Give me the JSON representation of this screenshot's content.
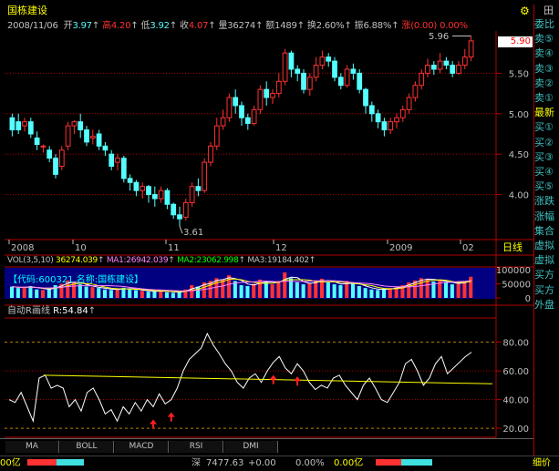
{
  "header": {
    "stock_name": "国栋建设",
    "date": "2008/11/06",
    "open_label": "开",
    "open": "3.97",
    "high_label": "高",
    "high": "4.20",
    "low_label": "低",
    "low": "3.92",
    "close_label": "收",
    "close": "4.07",
    "vol_label": "量",
    "vol": "36274",
    "amount_label": "额",
    "amount": "1489",
    "turnover_label": "换",
    "turnover": "2.60%",
    "amplitude_label": "振",
    "amplitude": "6.88%",
    "change_label": "涨",
    "change": "(0.00)",
    "change_pct": "0.00%",
    "top_icon": "settings-gear-icon",
    "top_right_text": "田"
  },
  "price_chart": {
    "y_ticks": [
      "5.50",
      "5.00",
      "4.50",
      "4.00"
    ],
    "current_price": "5.90",
    "high_note": "5.96",
    "low_note": "3.61",
    "x_labels": [
      "2008",
      "10",
      "11",
      "12",
      "2009",
      "02"
    ],
    "period": "日线"
  },
  "volume": {
    "label": "VOL(3,5,10)",
    "vol_value": "36274.039",
    "ma1": "MA1:26942.039",
    "ma2": "MA2:23062.998",
    "ma3": "MA3:19184.402",
    "code_caption": "【代码:600321 名称:国栋建设】",
    "y_ticks": [
      "100000",
      "50000",
      "0"
    ]
  },
  "indicator": {
    "name": "自动R画线",
    "value_label": "R:54.84",
    "y_ticks": [
      "80.00",
      "60.00",
      "40.00",
      "20.00"
    ]
  },
  "tabs": [
    "MA",
    "BOLL",
    "MACD",
    "RSI",
    "DMI"
  ],
  "sidebar": [
    "委比",
    "卖⑤",
    "卖④",
    "卖③",
    "卖②",
    "卖①",
    "最新",
    "买①",
    "买②",
    "买③",
    "买④",
    "买⑤",
    "涨跌",
    "涨幅",
    "集合",
    "虚拟",
    "虚拟",
    "买方",
    "买方",
    "外盘"
  ],
  "status_bar": {
    "left": "00亿",
    "index_name": "深",
    "index_value": "7477.63",
    "index_change": "+0.00",
    "index_pct": "0.00%",
    "index_amount": "0.00亿",
    "right": "细价"
  },
  "colors": {
    "up": "#ff3232",
    "down": "#54ffff",
    "ma_white": "#ffffff",
    "ma_yellow": "#ffff00",
    "ma_magenta": "#ff80ff",
    "ma_green": "#00ff00",
    "grid": "#b00000",
    "panel_blue": "#000080"
  },
  "chart_data": {
    "type": "candlestick",
    "title": "国栋建设",
    "ylim": [
      3.5,
      6.0
    ],
    "x_labels": [
      "2008",
      "10",
      "11",
      "12",
      "2009",
      "02"
    ],
    "ohlc": [
      [
        4.95,
        4.8,
        5.0,
        4.72
      ],
      [
        4.9,
        4.8,
        5.0,
        4.75
      ],
      [
        4.85,
        4.9,
        4.95,
        4.78
      ],
      [
        4.9,
        4.75,
        4.95,
        4.7
      ],
      [
        4.7,
        4.62,
        4.78,
        4.55
      ],
      [
        4.6,
        4.6,
        4.62,
        4.52
      ],
      [
        4.55,
        4.45,
        4.6,
        4.4
      ],
      [
        4.45,
        4.25,
        4.5,
        4.2
      ],
      [
        4.35,
        4.55,
        4.6,
        4.3
      ],
      [
        4.6,
        4.85,
        4.9,
        4.55
      ],
      [
        4.85,
        4.9,
        4.92,
        4.75
      ],
      [
        4.9,
        4.8,
        5.0,
        4.7
      ],
      [
        4.8,
        4.65,
        4.85,
        4.6
      ],
      [
        4.7,
        4.72,
        4.8,
        4.62
      ],
      [
        4.75,
        4.6,
        4.8,
        4.55
      ],
      [
        4.6,
        4.55,
        4.65,
        4.48
      ],
      [
        4.5,
        4.35,
        4.55,
        4.3
      ],
      [
        4.4,
        4.45,
        4.5,
        4.3
      ],
      [
        4.45,
        4.2,
        4.48,
        4.15
      ],
      [
        4.2,
        4.15,
        4.25,
        4.05
      ],
      [
        4.15,
        4.05,
        4.18,
        3.98
      ],
      [
        4.05,
        4.1,
        4.15,
        3.95
      ],
      [
        4.1,
        4.0,
        4.12,
        3.9
      ],
      [
        4.0,
        3.95,
        4.1,
        3.85
      ],
      [
        3.95,
        4.05,
        4.1,
        3.9
      ],
      [
        4.05,
        3.88,
        4.08,
        3.82
      ],
      [
        3.88,
        3.75,
        3.9,
        3.7
      ],
      [
        3.75,
        3.7,
        3.85,
        3.61
      ],
      [
        3.72,
        3.9,
        3.95,
        3.68
      ],
      [
        3.9,
        4.1,
        4.15,
        3.85
      ],
      [
        4.1,
        4.05,
        4.2,
        3.98
      ],
      [
        4.05,
        4.4,
        4.45,
        4.02
      ],
      [
        4.4,
        4.6,
        4.65,
        4.35
      ],
      [
        4.6,
        4.85,
        4.95,
        4.55
      ],
      [
        4.85,
        4.95,
        5.05,
        4.8
      ],
      [
        4.95,
        5.2,
        5.25,
        4.9
      ],
      [
        5.2,
        5.1,
        5.3,
        5.0
      ],
      [
        5.1,
        4.95,
        5.15,
        4.85
      ],
      [
        4.95,
        4.88,
        5.0,
        4.8
      ],
      [
        4.88,
        5.05,
        5.1,
        4.85
      ],
      [
        5.05,
        5.3,
        5.35,
        5.0
      ],
      [
        5.3,
        5.2,
        5.4,
        5.1
      ],
      [
        5.2,
        5.25,
        5.3,
        5.12
      ],
      [
        5.25,
        5.4,
        5.5,
        5.2
      ],
      [
        5.4,
        5.75,
        5.8,
        5.35
      ],
      [
        5.75,
        5.55,
        5.78,
        5.45
      ],
      [
        5.55,
        5.5,
        5.6,
        5.4
      ],
      [
        5.5,
        5.3,
        5.55,
        5.25
      ],
      [
        5.3,
        5.45,
        5.5,
        5.22
      ],
      [
        5.45,
        5.6,
        5.7,
        5.4
      ],
      [
        5.6,
        5.7,
        5.78,
        5.55
      ],
      [
        5.7,
        5.65,
        5.75,
        5.58
      ],
      [
        5.65,
        5.45,
        5.7,
        5.4
      ],
      [
        5.45,
        5.35,
        5.5,
        5.3
      ],
      [
        5.35,
        5.55,
        5.6,
        5.32
      ],
      [
        5.55,
        5.5,
        5.62,
        5.42
      ],
      [
        5.5,
        5.3,
        5.55,
        5.25
      ],
      [
        5.3,
        5.1,
        5.32,
        5.0
      ],
      [
        5.1,
        5.0,
        5.15,
        4.9
      ],
      [
        5.0,
        4.9,
        5.05,
        4.82
      ],
      [
        4.9,
        4.8,
        4.95,
        4.72
      ],
      [
        4.8,
        4.9,
        4.95,
        4.75
      ],
      [
        4.9,
        4.95,
        5.0,
        4.82
      ],
      [
        4.95,
        5.05,
        5.1,
        4.9
      ],
      [
        5.05,
        5.2,
        5.25,
        5.0
      ],
      [
        5.2,
        5.35,
        5.4,
        5.15
      ],
      [
        5.35,
        5.5,
        5.55,
        5.3
      ],
      [
        5.5,
        5.6,
        5.68,
        5.45
      ],
      [
        5.6,
        5.55,
        5.65,
        5.48
      ],
      [
        5.55,
        5.65,
        5.75,
        5.5
      ],
      [
        5.65,
        5.6,
        5.7,
        5.55
      ],
      [
        5.6,
        5.5,
        5.65,
        5.45
      ],
      [
        5.5,
        5.6,
        5.65,
        5.48
      ],
      [
        5.6,
        5.7,
        5.8,
        5.55
      ],
      [
        5.7,
        5.9,
        5.96,
        5.65
      ]
    ],
    "volume": [
      40,
      35,
      38,
      42,
      30,
      28,
      33,
      45,
      50,
      62,
      55,
      48,
      40,
      38,
      35,
      30,
      28,
      32,
      36,
      30,
      28,
      25,
      22,
      24,
      26,
      20,
      18,
      22,
      30,
      45,
      40,
      55,
      60,
      70,
      65,
      80,
      60,
      45,
      42,
      50,
      65,
      55,
      48,
      60,
      90,
      70,
      55,
      48,
      52,
      62,
      68,
      55,
      48,
      45,
      60,
      50,
      42,
      35,
      30,
      28,
      32,
      35,
      38,
      45,
      55,
      62,
      70,
      68,
      58,
      62,
      55,
      48,
      52,
      60,
      75
    ],
    "indicator": {
      "name": "自动R画线",
      "ylim": [
        15,
        95
      ],
      "r_line": [
        40,
        38,
        45,
        35,
        25,
        55,
        57,
        48,
        50,
        48,
        35,
        40,
        32,
        45,
        48,
        40,
        30,
        33,
        25,
        35,
        30,
        38,
        32,
        40,
        35,
        44,
        37,
        40,
        48,
        60,
        68,
        72,
        76,
        86,
        78,
        72,
        65,
        60,
        52,
        48,
        55,
        58,
        52,
        60,
        66,
        70,
        62,
        58,
        65,
        60,
        52,
        47,
        50,
        48,
        55,
        57,
        50,
        45,
        40,
        50,
        55,
        48,
        40,
        38,
        45,
        52,
        65,
        68,
        60,
        50,
        55,
        65,
        70,
        58,
        62,
        66,
        70,
        73
      ],
      "trend_line": [
        57,
        51
      ],
      "up_arrows": [
        24,
        27,
        44,
        48
      ]
    }
  }
}
